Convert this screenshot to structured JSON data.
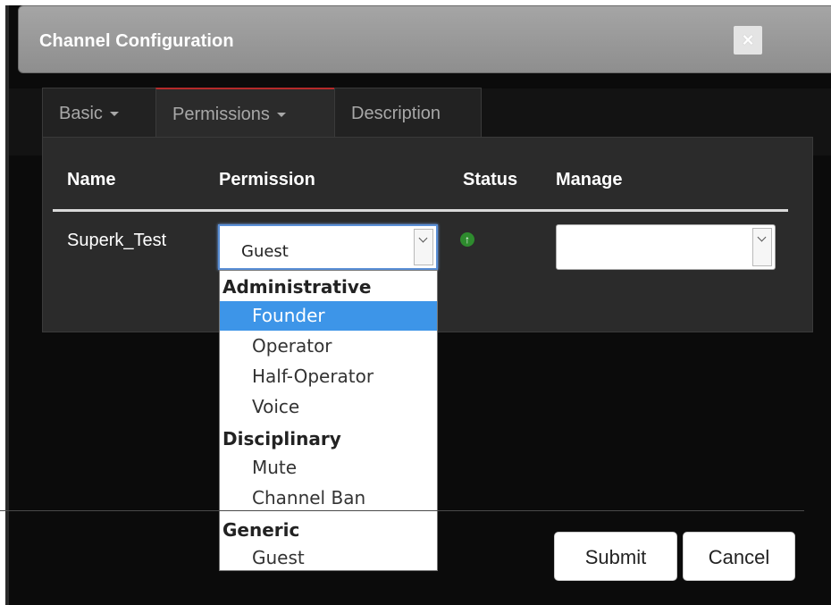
{
  "window": {
    "title": "Channel Configuration",
    "close_label": "×"
  },
  "tabs": [
    {
      "label": "Basic",
      "has_caret": true
    },
    {
      "label": "Permissions",
      "has_caret": true,
      "active": true
    },
    {
      "label": "Description",
      "has_caret": false
    }
  ],
  "table": {
    "headers": [
      "Name",
      "Permission",
      "Status",
      "Manage"
    ],
    "rows": [
      {
        "name": "Superk_Test",
        "permission": "Guest",
        "status_icon": "arrow-up-circle-icon",
        "manage": ""
      }
    ]
  },
  "dropdown": {
    "groups": [
      {
        "label": "Administrative",
        "options": [
          "Founder",
          "Operator",
          "Half-Operator",
          "Voice"
        ]
      },
      {
        "label": "Disciplinary",
        "options": [
          "Mute",
          "Channel Ban"
        ]
      },
      {
        "label": "Generic",
        "options": [
          "Guest"
        ]
      }
    ],
    "highlighted": "Founder"
  },
  "footer": {
    "submit_label": "Submit",
    "cancel_label": "Cancel"
  },
  "colors": {
    "accent_highlight": "#3d95e8",
    "status_green": "#2e8b2e",
    "active_tab_border": "#b52a2a"
  }
}
